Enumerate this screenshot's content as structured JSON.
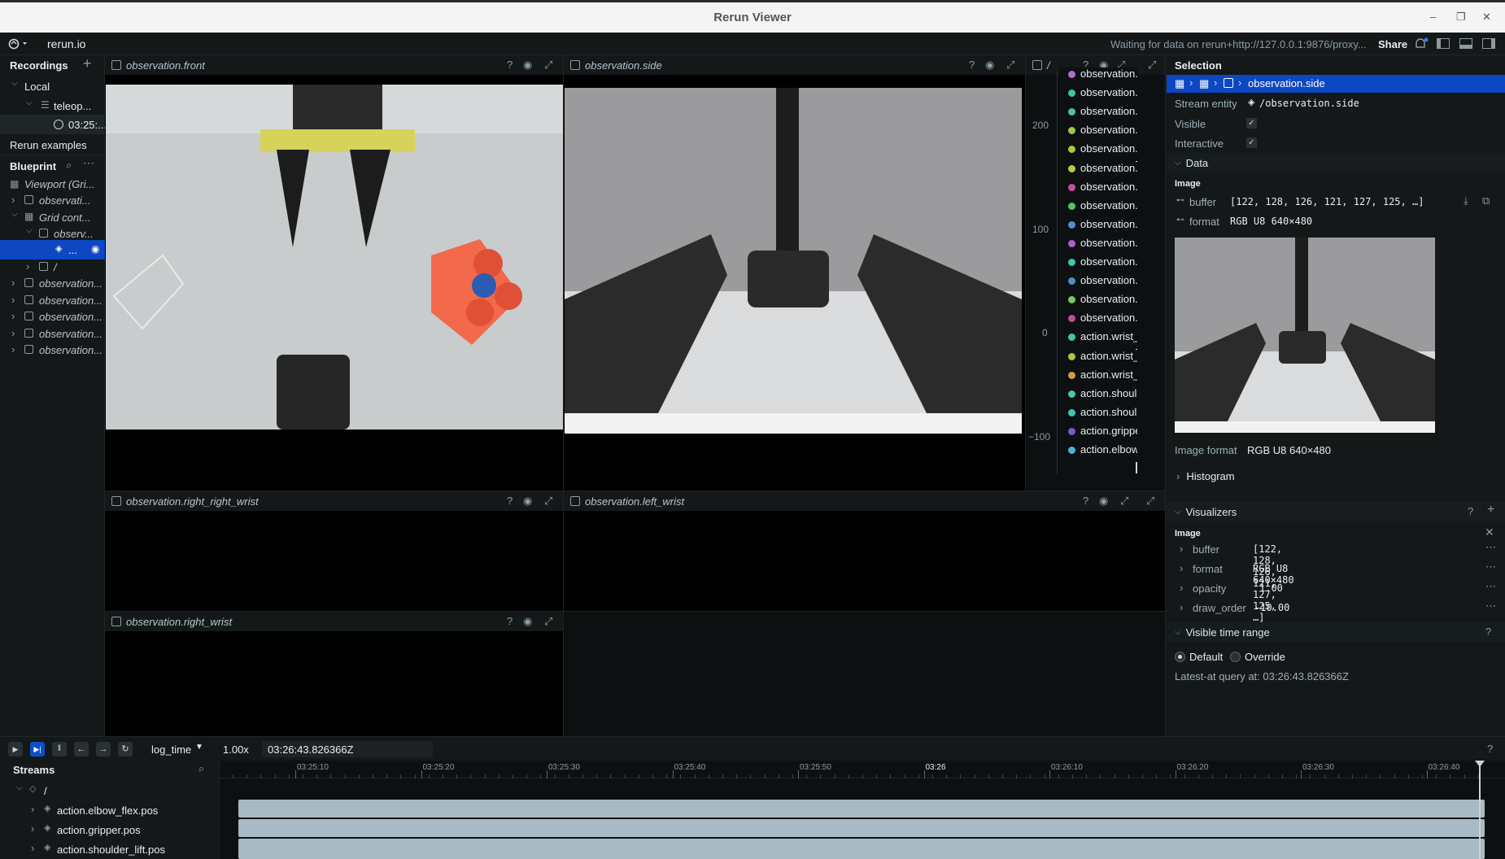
{
  "window": {
    "title": "Rerun Viewer",
    "minimize": "–",
    "restore": "❐",
    "close": "✕"
  },
  "topbar": {
    "brand": "rerun.io",
    "status": "Waiting for data on rerun+http://127.0.0.1:9876/proxy...",
    "share": "Share"
  },
  "recordings": {
    "title": "Recordings",
    "add": "+",
    "local": "Local",
    "app": "teleop...",
    "recording": "03:25:...",
    "examples": "Rerun examples"
  },
  "blueprint": {
    "title": "Blueprint",
    "items": [
      {
        "label": "Viewport (Gri..."
      },
      {
        "label": "observati..."
      },
      {
        "label": "Grid cont..."
      },
      {
        "label": "observ..."
      },
      {
        "label": "..."
      },
      {
        "label": "/"
      },
      {
        "label": "observation..."
      },
      {
        "label": "observation..."
      },
      {
        "label": "observation..."
      },
      {
        "label": "observation..."
      },
      {
        "label": "observation..."
      }
    ]
  },
  "views": {
    "front": "observation.front",
    "side": "observation.side",
    "plot": "/",
    "right_right_wrist": "observation.right_right_wrist",
    "left_wrist": "observation.left_wrist",
    "right_wrist": "observation.right_wrist",
    "help": "?"
  },
  "plot": {
    "y_ticks": [
      "200",
      "100",
      "0",
      "−100"
    ],
    "legend": [
      {
        "label": "observation.",
        "color": "#b36bd1"
      },
      {
        "label": "observation.",
        "color": "#3fc4a4"
      },
      {
        "label": "observation.",
        "color": "#4fc1a5"
      },
      {
        "label": "observation.",
        "color": "#9ac94b"
      },
      {
        "label": "observation.",
        "color": "#a8c83d"
      },
      {
        "label": "observation.",
        "color": "#c0c44a"
      },
      {
        "label": "observation.",
        "color": "#c64f9c"
      },
      {
        "label": "observation.",
        "color": "#4fc26b"
      },
      {
        "label": "observation.",
        "color": "#5b87d6"
      },
      {
        "label": "observation.",
        "color": "#b45ad0"
      },
      {
        "label": "observation.",
        "color": "#3ec4b2"
      },
      {
        "label": "observation.",
        "color": "#4f8fcf"
      },
      {
        "label": "observation.",
        "color": "#74c95a"
      },
      {
        "label": "observation.",
        "color": "#c14c9e"
      },
      {
        "label": "action.wrist_",
        "color": "#43c79a"
      },
      {
        "label": "action.wrist_",
        "color": "#a5c94a"
      },
      {
        "label": "action.wrist_",
        "color": "#d09a4c"
      },
      {
        "label": "action.shoulc",
        "color": "#4ec3ab"
      },
      {
        "label": "action.shoulc",
        "color": "#3fc4b3"
      },
      {
        "label": "action.gripper",
        "color": "#7b58cc"
      },
      {
        "label": "action.elbow",
        "color": "#4db3d3"
      }
    ]
  },
  "selection": {
    "title": "Selection",
    "breadcrumb": "observation.side",
    "stream_entity_label": "Stream entity",
    "stream_entity_value": "/observation.side",
    "visible_label": "Visible",
    "interactive_label": "Interactive",
    "data_section": "Data",
    "image_label": "Image",
    "buffer_label": "buffer",
    "buffer_value": "[122, 128, 126, 121, 127, 125, …]",
    "format_label": "format",
    "format_value": "RGB U8 640×480",
    "image_format_label": "Image format",
    "image_format_value": "RGB U8 640×480",
    "histogram": "Histogram",
    "visualizers": "Visualizers",
    "vis_image": "Image",
    "vis_rows": [
      {
        "label": "buffer",
        "value": "[122, 128, 126, 121, 127, 125, …]"
      },
      {
        "label": "format",
        "value": "RGB U8 640×480"
      },
      {
        "label": "opacity",
        "value": "1.00"
      },
      {
        "label": "draw_order",
        "value": "-10.00"
      }
    ],
    "visible_time_range": "Visible time range",
    "default_label": "Default",
    "override_label": "Override",
    "latest_at": "Latest-at query at: 03:26:43.826366Z"
  },
  "timeline": {
    "timeline_name": "log_time",
    "speed": "1.00x",
    "current_time": "03:26:43.826366Z",
    "ticks": [
      "03:25:10",
      "03:25:20",
      "03:25:30",
      "03:25:40",
      "03:25:50",
      "03:26",
      "03:26:10",
      "03:26:20",
      "03:26:30",
      "03:26:40"
    ],
    "streams_title": "Streams",
    "root": "/",
    "streams": [
      "action.elbow_flex.pos",
      "action.gripper.pos",
      "action.shoulder_lift.pos"
    ]
  },
  "colors": {
    "accent": "#0b50c7",
    "selection_bg": "#0d47c1",
    "data_bar": "#a8bac4",
    "panel_bg": "#141819",
    "view_bg": "#000000"
  }
}
